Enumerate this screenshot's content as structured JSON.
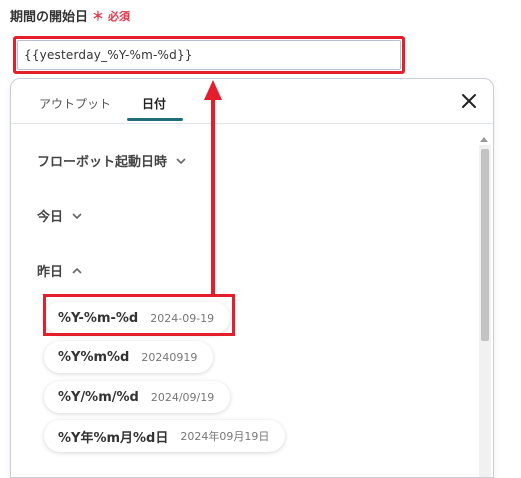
{
  "field": {
    "label": "期間の開始日",
    "required_mark": "＊",
    "required_text": "必須",
    "value": "{{yesterday_%Y-%m-%d}}"
  },
  "popup": {
    "tabs": [
      {
        "label": "アウトプット",
        "active": false
      },
      {
        "label": "日付",
        "active": true
      }
    ],
    "sections": [
      {
        "label": "フローボット起動日時",
        "expanded": false
      },
      {
        "label": "今日",
        "expanded": false
      },
      {
        "label": "昨日",
        "expanded": true
      }
    ],
    "options": [
      {
        "format": "%Y-%m-%d",
        "example": "2024-09-19"
      },
      {
        "format": "%Y%m%d",
        "example": "20240919"
      },
      {
        "format": "%Y/%m/%d",
        "example": "2024/09/19"
      },
      {
        "format": "%Y年%m月%d日",
        "example": "2024年09月19日"
      }
    ]
  },
  "colors": {
    "annotation_red": "#e41e2b",
    "tab_underline": "#1f6e7a",
    "required": "#e0364a"
  },
  "icons": [
    "close-icon",
    "chevron-down-icon",
    "chevron-up-icon"
  ]
}
